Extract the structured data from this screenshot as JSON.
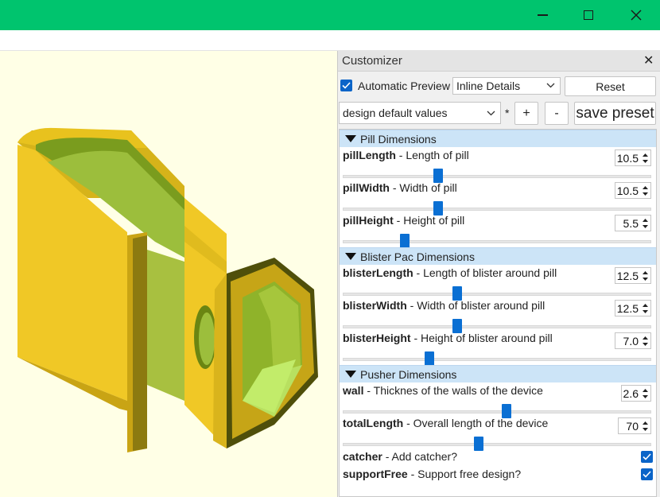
{
  "window": {
    "controls": [
      "minimize",
      "maximize",
      "close"
    ]
  },
  "colors": {
    "titlebar": "#00c46e",
    "accent": "#0a64c8",
    "group_header": "#cce4f7",
    "viewport_bg": "#ffffe6"
  },
  "customizer": {
    "title": "Customizer",
    "close_glyph": "✕",
    "automatic_preview": {
      "label": "Automatic Preview",
      "checked": true
    },
    "details_select": {
      "value": "Inline Details"
    },
    "reset_label": "Reset",
    "preset_select": {
      "value": "design default values"
    },
    "preset_modified_mark": "*",
    "add_label": "+",
    "remove_label": "-",
    "save_preset_label": "save preset"
  },
  "groups": [
    {
      "label": "Pill Dimensions",
      "params": [
        {
          "name": "pillLength",
          "desc": " - Length of pill",
          "value": "10.5",
          "slider": 0.31
        },
        {
          "name": "pillWidth",
          "desc": " - Width of pill",
          "value": "10.5",
          "slider": 0.31
        },
        {
          "name": "pillHeight",
          "desc": " - Height of pill",
          "value": "5.5",
          "slider": 0.2
        }
      ]
    },
    {
      "label": "Blister Pac Dimensions",
      "params": [
        {
          "name": "blisterLength",
          "desc": " - Length of blister around pill",
          "value": "12.5",
          "slider": 0.37
        },
        {
          "name": "blisterWidth",
          "desc": " - Width of blister around pill",
          "value": "12.5",
          "slider": 0.37
        },
        {
          "name": "blisterHeight",
          "desc": " - Height of blister around pill",
          "value": "7.0",
          "slider": 0.28
        }
      ]
    },
    {
      "label": "Pusher Dimensions",
      "params": [
        {
          "name": "wall",
          "desc": " - Thicknes of the walls of the device",
          "value": "2.6",
          "slider": 0.53
        },
        {
          "name": "totalLength",
          "desc": " - Overall length of the device",
          "value": "70",
          "slider": 0.44
        }
      ],
      "booleans": [
        {
          "name": "catcher",
          "desc": " - Add catcher?",
          "checked": true
        },
        {
          "name": "supportFree",
          "desc": " - Support free design?",
          "checked": true
        }
      ]
    }
  ]
}
